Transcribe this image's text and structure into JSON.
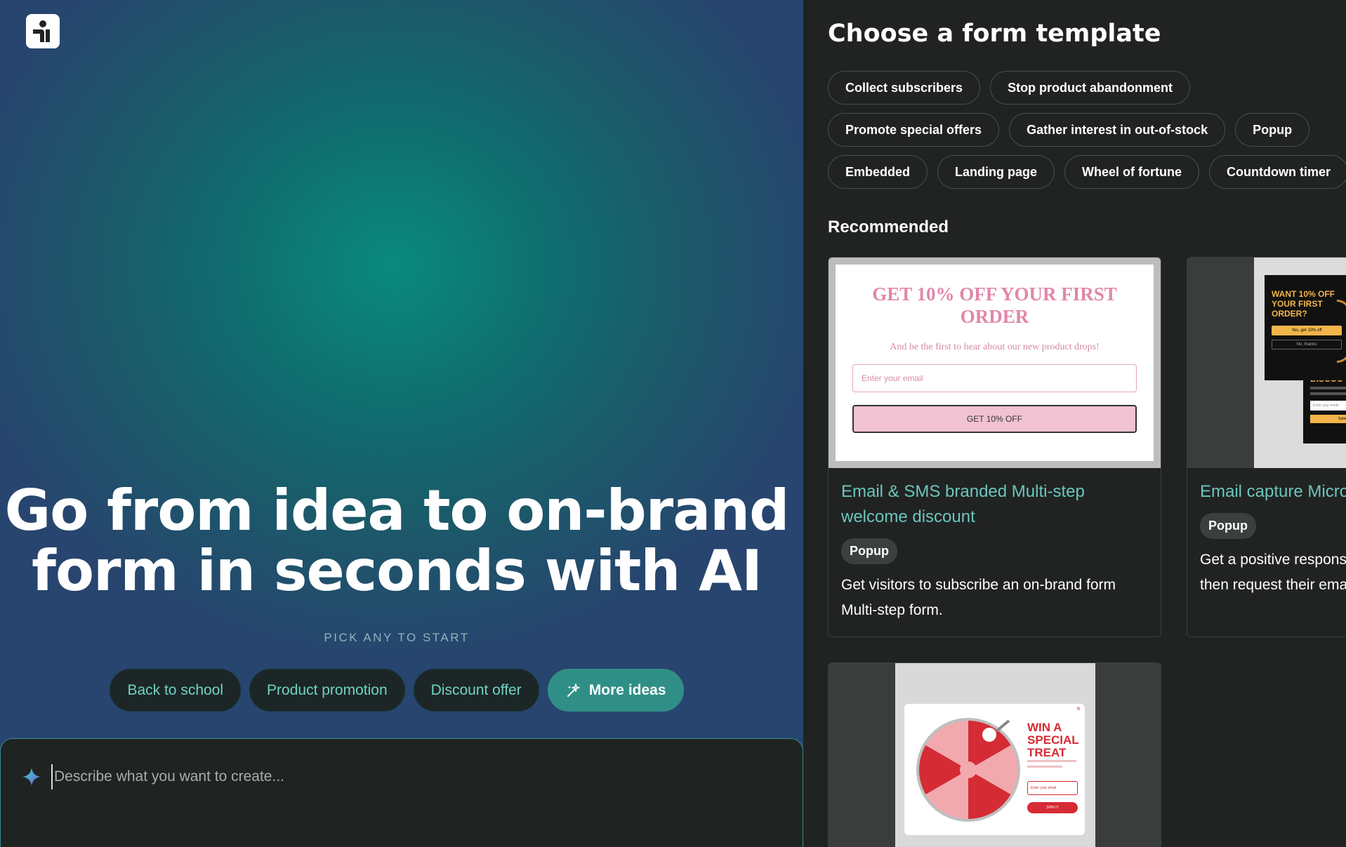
{
  "left": {
    "hero_title": "Go from idea to on-brand form in seconds with AI",
    "pick_label": "PICK ANY TO START",
    "ideas": [
      "Back to school",
      "Product promotion",
      "Discount offer"
    ],
    "more_ideas_label": "More ideas",
    "prompt": {
      "placeholder": "Describe what you want to create..."
    }
  },
  "right": {
    "title": "Choose a form template",
    "chips": [
      "Collect subscribers",
      "Stop product abandonment",
      "Promote special offers",
      "Gather interest in out-of-stock",
      "Popup",
      "Embedded",
      "Landing page",
      "Wheel of fortune",
      "Countdown timer"
    ],
    "recommended_label": "Recommended",
    "cards": [
      {
        "title": "Email & SMS branded Multi-step welcome discount",
        "tag": "Popup",
        "description": "Get visitors to subscribe an on-brand form Multi-step form.",
        "preview": {
          "headline": "GET 10% OFF YOUR FIRST ORDER",
          "subline": "And be the first to hear about our new product drops!",
          "email_placeholder": "Enter your email",
          "button": "GET 10% OFF"
        }
      },
      {
        "title": "Email capture Micro",
        "tag": "Popup",
        "description": "Get a positive respons then request their ema",
        "preview": {
          "headline": "WANT 10% OFF YOUR FIRST ORDER?",
          "yes_button": "Yes, get 10% off",
          "no_button": "No, thanks",
          "second_title": "DISCOU",
          "email_placeholder": "Enter your email",
          "submit": "Submit"
        }
      },
      {
        "preview": {
          "headline": "WIN A SPECIAL TREAT",
          "email_placeholder": "Enter your email",
          "button": "SPIN IT",
          "close": "×"
        }
      }
    ]
  },
  "colors": {
    "accent_teal": "#6cc6bd",
    "more_ideas_bg": "#2f8f87",
    "panel_bg": "#202322",
    "pink_headline": "#e186a9",
    "wheel_red": "#d52b34"
  }
}
